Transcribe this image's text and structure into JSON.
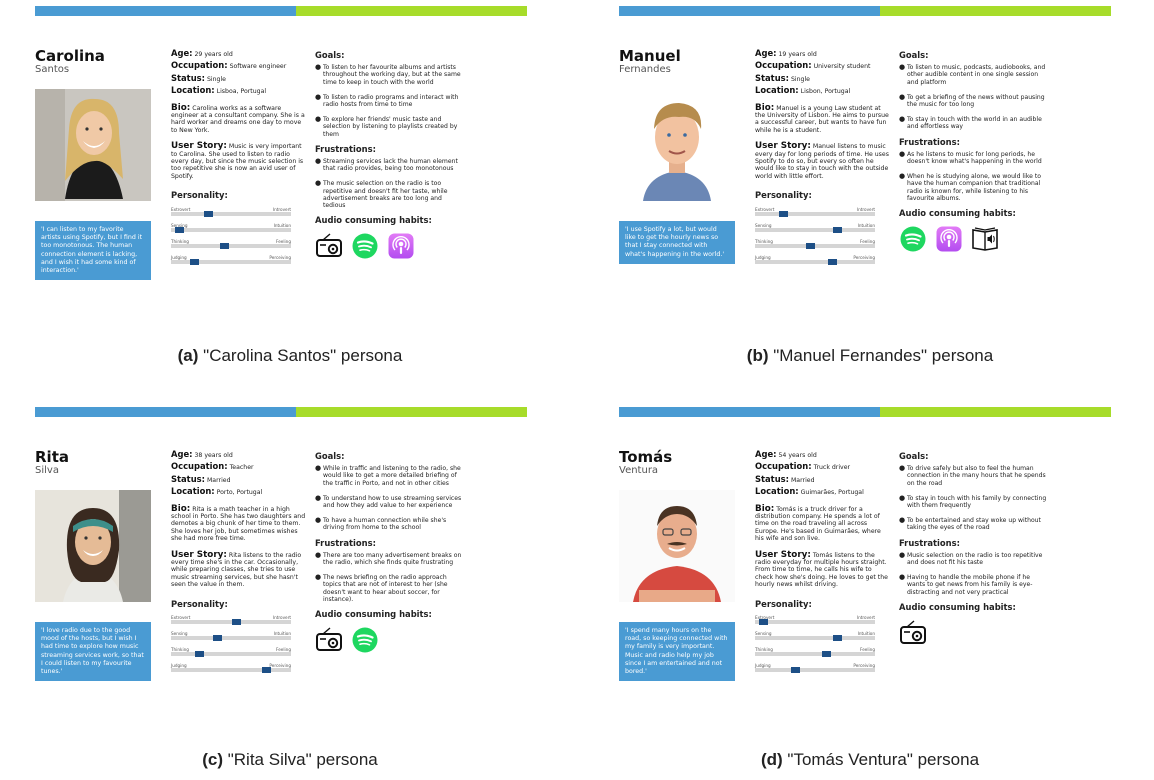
{
  "personas": [
    {
      "first": "Carolina",
      "last": "Santos",
      "age": "29 years old",
      "occupation": "Software engineer",
      "status": "Single",
      "location": "Lisboa, Portugal",
      "bio": "Carolina works as a software engineer at a consultant company. She is a hard worker and dreams one day to move to New York.",
      "user_story": "Music is very important to Carolina. She used to listen to radio every day, but since the music selection is too repetitive she is now an avid user of Spotify.",
      "quote": "'I can listen to my favorite artists using Spotify, but I find it too monotonous. The human connection element is lacking, and I wish it had some kind of interaction.'",
      "goals": [
        "To listen to her favourite albums and artists throughout the working day, but at the same time to keep in touch with the world",
        "To listen to radio programs and interact with radio hosts from time to time",
        "To explore her friends' music taste and selection by listening to playlists created by them"
      ],
      "frustrations": [
        "Streaming services lack the human element that radio provides, being too monotonous",
        "The music selection on the radio is too repetitive and doesn't fit her taste, while advertisement breaks are too long and tedious"
      ],
      "personality": [
        0.3,
        0.04,
        0.44,
        0.17
      ],
      "habits": [
        "radio-icon",
        "spotify-icon",
        "podcast-icon"
      ],
      "caption_tag": "(a)",
      "caption_text": "\"Carolina Santos\" persona"
    },
    {
      "first": "Manuel",
      "last": "Fernandes",
      "age": "19 years old",
      "occupation": "University student",
      "status": "Single",
      "location": "Lisbon, Portugal",
      "bio": "Manuel is a young Law student at the University of Lisbon. He aims to pursue a successful career, but wants to have fun while he is a student.",
      "user_story": "Manuel listens to music every day for long periods of time. He uses Spotify to do so, but every so often he would like to stay in touch with the outside world with little effort.",
      "quote": "'I use Spotify a lot, but would like to get the hourly news so that I stay connected with what's happening in the world.'",
      "goals": [
        "To listen to music, podcasts, audiobooks, and other audible content in one single session and platform",
        "To get a briefing of the news without pausing the music for too long",
        "To stay in touch with the world in an audible and effortless way"
      ],
      "frustrations": [
        "As he listens to music for long periods, he doesn't know what's happening in the world",
        "When he is studying alone, we would like to have the human companion that traditional radio is known for, while listening to his favourite albums."
      ],
      "personality": [
        0.22,
        0.7,
        0.46,
        0.66
      ],
      "habits": [
        "spotify-icon",
        "podcast-icon",
        "audiobook-icon"
      ],
      "caption_tag": "(b)",
      "caption_text": "\"Manuel Fernandes\" persona"
    },
    {
      "first": "Rita",
      "last": "Silva",
      "age": "38 years old",
      "occupation": "Teacher",
      "status": "Married",
      "location": "Porto, Portugal",
      "bio": "Rita is a math teacher in a high school in Porto. She has two daughters and demotes a big chunk of her time to them. She loves her job, but sometimes wishes she had more free time.",
      "user_story": "Rita listens to the radio every time she's in the car. Occasionally, while preparing classes, she tries to use music streaming services, but she hasn't seen the value in them.",
      "quote": "'I love radio due to the good mood of the hosts, but I wish I had time to explore how music streaming services work, so that I could listen to my favourite tunes.'",
      "goals": [
        "While in traffic and listening to the radio, she would like to get a more detailed briefing of the traffic in Porto, and not in other cities",
        "To understand how to use streaming services and how they add value to her experience",
        "To have a human connection while she's driving from home to the school"
      ],
      "frustrations": [
        "There are too many advertisement breaks on the radio, which she finds quite frustrating",
        "The news briefing on the radio approach topics that are not of interest to her (she doesn't want to hear about soccer, for instance)."
      ],
      "personality": [
        0.55,
        0.38,
        0.22,
        0.82
      ],
      "habits": [
        "radio-icon",
        "spotify-icon"
      ],
      "caption_tag": "(c)",
      "caption_text": "\"Rita Silva\" persona"
    },
    {
      "first": "Tomás",
      "last": "Ventura",
      "age": "54 years old",
      "occupation": "Truck driver",
      "status": "Married",
      "location": "Guimarães, Portugal",
      "bio": "Tomás is a truck driver for a distribution company. He spends a lot of time on the road traveling all across Europe. He's based in Guimarães, where his wife and son live.",
      "user_story": "Tomás listens to the radio everyday for multiple hours straight. From time to time, he calls his wife to check how she's doing. He loves to get the hourly news whilst driving.",
      "quote": "'I spend many hours on the road, so keeping connected with my family is very important. Music and radio help my job since I am entertained and not bored.'",
      "goals": [
        "To drive safely but also to feel the human connection in the many hours that he spends on the road",
        "To stay in touch with his family by connecting with them frequently",
        "To be entertained and stay woke up without taking the eyes of the road"
      ],
      "frustrations": [
        "Music selection on the radio is too repetitive and does not fit his taste",
        "Having to handle the mobile phone if he wants to get news from his family is eye-distracting and not very practical"
      ],
      "personality": [
        0.04,
        0.7,
        0.6,
        0.32
      ],
      "habits": [
        "radio-icon"
      ],
      "caption_tag": "(d)",
      "caption_text": "\"Tomás Ventura\" persona"
    }
  ],
  "labels": {
    "age": "Age:",
    "occupation": "Occupation:",
    "status": "Status:",
    "location": "Location:",
    "bio": "Bio:",
    "user_story": "User Story:",
    "goals": "Goals:",
    "frustrations": "Frustrations:",
    "personality": "Personality:",
    "habits": "Audio consuming habits:",
    "sliders": [
      [
        "Extrovert",
        "Introvert"
      ],
      [
        "Sensing",
        "Intuition"
      ],
      [
        "Thinking",
        "Feeling"
      ],
      [
        "Judging",
        "Perceiving"
      ]
    ]
  },
  "colors": {
    "blue_bar": "#4a9bd3",
    "green_bar": "#a7dc2a",
    "knob": "#1d4f86",
    "spotify": "#1ed760",
    "podcast": "#b34cf0"
  }
}
